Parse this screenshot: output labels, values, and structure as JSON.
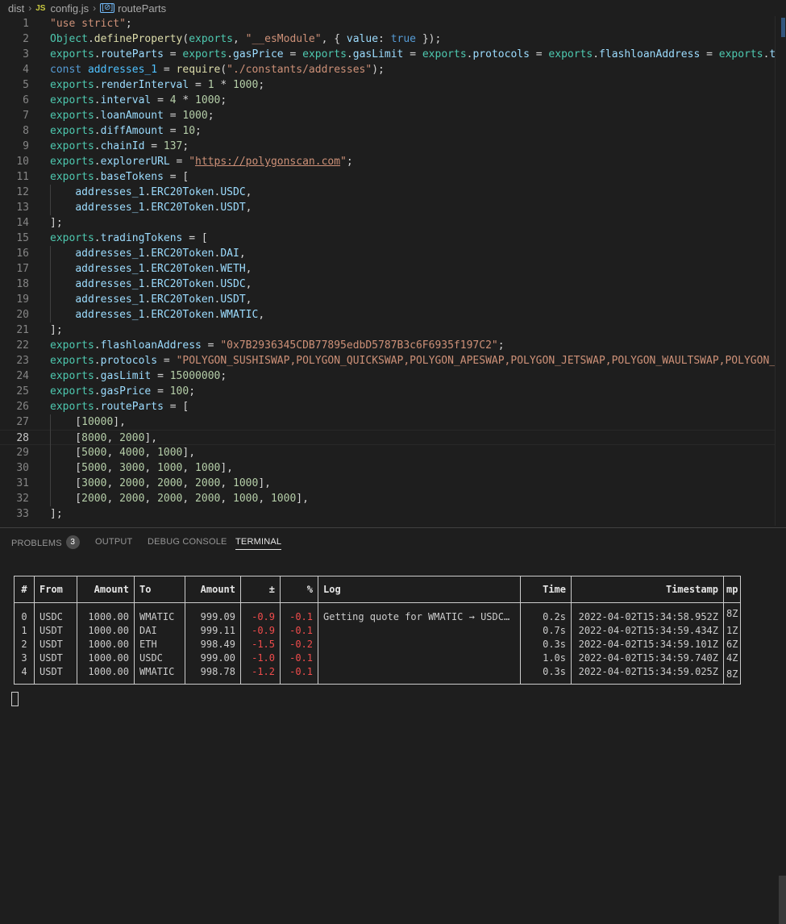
{
  "breadcrumb": {
    "folder": "dist",
    "file_badge": "JS",
    "file": "config.js",
    "symbol_badge": "[⊘]",
    "symbol": "routeParts"
  },
  "editor": {
    "active_line": 28,
    "lines": [
      {
        "n": "1",
        "t": [
          [
            "str",
            "\"use strict\""
          ],
          [
            "pun",
            ";"
          ]
        ]
      },
      {
        "n": "2",
        "t": [
          [
            "var",
            "Object"
          ],
          [
            "pun",
            "."
          ],
          [
            "fn",
            "defineProperty"
          ],
          [
            "pun",
            "("
          ],
          [
            "var",
            "exports"
          ],
          [
            "pun",
            ", "
          ],
          [
            "str",
            "\"__esModule\""
          ],
          [
            "pun",
            ", { "
          ],
          [
            "prop",
            "value"
          ],
          [
            "pun",
            ": "
          ],
          [
            "kw",
            "true"
          ],
          [
            "pun",
            " });"
          ]
        ]
      },
      {
        "n": "3",
        "t": [
          [
            "var",
            "exports"
          ],
          [
            "pun",
            "."
          ],
          [
            "prop",
            "routeParts"
          ],
          [
            "pun",
            " = "
          ],
          [
            "var",
            "exports"
          ],
          [
            "pun",
            "."
          ],
          [
            "prop",
            "gasPrice"
          ],
          [
            "pun",
            " = "
          ],
          [
            "var",
            "exports"
          ],
          [
            "pun",
            "."
          ],
          [
            "prop",
            "gasLimit"
          ],
          [
            "pun",
            " = "
          ],
          [
            "var",
            "exports"
          ],
          [
            "pun",
            "."
          ],
          [
            "prop",
            "protocols"
          ],
          [
            "pun",
            " = "
          ],
          [
            "var",
            "exports"
          ],
          [
            "pun",
            "."
          ],
          [
            "prop",
            "flashloanAddress"
          ],
          [
            "pun",
            " = "
          ],
          [
            "var",
            "exports"
          ],
          [
            "pun",
            "."
          ],
          [
            "prop",
            "tra"
          ]
        ]
      },
      {
        "n": "4",
        "t": [
          [
            "kw",
            "const "
          ],
          [
            "cst",
            "addresses_1"
          ],
          [
            "pun",
            " = "
          ],
          [
            "fn",
            "require"
          ],
          [
            "pun",
            "("
          ],
          [
            "str",
            "\"./constants/addresses\""
          ],
          [
            "pun",
            ");"
          ]
        ]
      },
      {
        "n": "5",
        "t": [
          [
            "var",
            "exports"
          ],
          [
            "pun",
            "."
          ],
          [
            "prop",
            "renderInterval"
          ],
          [
            "pun",
            " = "
          ],
          [
            "num",
            "1"
          ],
          [
            "pun",
            " * "
          ],
          [
            "num",
            "1000"
          ],
          [
            "pun",
            ";"
          ]
        ]
      },
      {
        "n": "6",
        "t": [
          [
            "var",
            "exports"
          ],
          [
            "pun",
            "."
          ],
          [
            "prop",
            "interval"
          ],
          [
            "pun",
            " = "
          ],
          [
            "num",
            "4"
          ],
          [
            "pun",
            " * "
          ],
          [
            "num",
            "1000"
          ],
          [
            "pun",
            ";"
          ]
        ]
      },
      {
        "n": "7",
        "t": [
          [
            "var",
            "exports"
          ],
          [
            "pun",
            "."
          ],
          [
            "prop",
            "loanAmount"
          ],
          [
            "pun",
            " = "
          ],
          [
            "num",
            "1000"
          ],
          [
            "pun",
            ";"
          ]
        ]
      },
      {
        "n": "8",
        "t": [
          [
            "var",
            "exports"
          ],
          [
            "pun",
            "."
          ],
          [
            "prop",
            "diffAmount"
          ],
          [
            "pun",
            " = "
          ],
          [
            "num",
            "10"
          ],
          [
            "pun",
            ";"
          ]
        ]
      },
      {
        "n": "9",
        "t": [
          [
            "var",
            "exports"
          ],
          [
            "pun",
            "."
          ],
          [
            "prop",
            "chainId"
          ],
          [
            "pun",
            " = "
          ],
          [
            "num",
            "137"
          ],
          [
            "pun",
            ";"
          ]
        ]
      },
      {
        "n": "10",
        "t": [
          [
            "var",
            "exports"
          ],
          [
            "pun",
            "."
          ],
          [
            "prop",
            "explorerURL"
          ],
          [
            "pun",
            " = "
          ],
          [
            "str",
            "\""
          ],
          [
            "link",
            "https://polygonscan.com"
          ],
          [
            "str",
            "\""
          ],
          [
            "pun",
            ";"
          ]
        ]
      },
      {
        "n": "11",
        "t": [
          [
            "var",
            "exports"
          ],
          [
            "pun",
            "."
          ],
          [
            "prop",
            "baseTokens"
          ],
          [
            "pun",
            " = ["
          ]
        ]
      },
      {
        "n": "12",
        "t": [
          [
            "pun",
            "    "
          ],
          [
            "prop",
            "addresses_1"
          ],
          [
            "pun",
            "."
          ],
          [
            "prop",
            "ERC20Token"
          ],
          [
            "pun",
            "."
          ],
          [
            "prop",
            "USDC"
          ],
          [
            "pun",
            ","
          ]
        ]
      },
      {
        "n": "13",
        "t": [
          [
            "pun",
            "    "
          ],
          [
            "prop",
            "addresses_1"
          ],
          [
            "pun",
            "."
          ],
          [
            "prop",
            "ERC20Token"
          ],
          [
            "pun",
            "."
          ],
          [
            "prop",
            "USDT"
          ],
          [
            "pun",
            ","
          ]
        ]
      },
      {
        "n": "14",
        "t": [
          [
            "pun",
            "];"
          ]
        ]
      },
      {
        "n": "15",
        "t": [
          [
            "var",
            "exports"
          ],
          [
            "pun",
            "."
          ],
          [
            "prop",
            "tradingTokens"
          ],
          [
            "pun",
            " = ["
          ]
        ]
      },
      {
        "n": "16",
        "t": [
          [
            "pun",
            "    "
          ],
          [
            "prop",
            "addresses_1"
          ],
          [
            "pun",
            "."
          ],
          [
            "prop",
            "ERC20Token"
          ],
          [
            "pun",
            "."
          ],
          [
            "prop",
            "DAI"
          ],
          [
            "pun",
            ","
          ]
        ]
      },
      {
        "n": "17",
        "t": [
          [
            "pun",
            "    "
          ],
          [
            "prop",
            "addresses_1"
          ],
          [
            "pun",
            "."
          ],
          [
            "prop",
            "ERC20Token"
          ],
          [
            "pun",
            "."
          ],
          [
            "prop",
            "WETH"
          ],
          [
            "pun",
            ","
          ]
        ]
      },
      {
        "n": "18",
        "t": [
          [
            "pun",
            "    "
          ],
          [
            "prop",
            "addresses_1"
          ],
          [
            "pun",
            "."
          ],
          [
            "prop",
            "ERC20Token"
          ],
          [
            "pun",
            "."
          ],
          [
            "prop",
            "USDC"
          ],
          [
            "pun",
            ","
          ]
        ]
      },
      {
        "n": "19",
        "t": [
          [
            "pun",
            "    "
          ],
          [
            "prop",
            "addresses_1"
          ],
          [
            "pun",
            "."
          ],
          [
            "prop",
            "ERC20Token"
          ],
          [
            "pun",
            "."
          ],
          [
            "prop",
            "USDT"
          ],
          [
            "pun",
            ","
          ]
        ]
      },
      {
        "n": "20",
        "t": [
          [
            "pun",
            "    "
          ],
          [
            "prop",
            "addresses_1"
          ],
          [
            "pun",
            "."
          ],
          [
            "prop",
            "ERC20Token"
          ],
          [
            "pun",
            "."
          ],
          [
            "prop",
            "WMATIC"
          ],
          [
            "pun",
            ","
          ]
        ]
      },
      {
        "n": "21",
        "t": [
          [
            "pun",
            "];"
          ]
        ]
      },
      {
        "n": "22",
        "t": [
          [
            "var",
            "exports"
          ],
          [
            "pun",
            "."
          ],
          [
            "prop",
            "flashloanAddress"
          ],
          [
            "pun",
            " = "
          ],
          [
            "str",
            "\"0x7B2936345CDB77895edbD5787B3c6F6935f197C2\""
          ],
          [
            "pun",
            ";"
          ]
        ]
      },
      {
        "n": "23",
        "t": [
          [
            "var",
            "exports"
          ],
          [
            "pun",
            "."
          ],
          [
            "prop",
            "protocols"
          ],
          [
            "pun",
            " = "
          ],
          [
            "str",
            "\"POLYGON_SUSHISWAP,POLYGON_QUICKSWAP,POLYGON_APESWAP,POLYGON_JETSWAP,POLYGON_WAULTSWAP,POLYGON_UN"
          ]
        ]
      },
      {
        "n": "24",
        "t": [
          [
            "var",
            "exports"
          ],
          [
            "pun",
            "."
          ],
          [
            "prop",
            "gasLimit"
          ],
          [
            "pun",
            " = "
          ],
          [
            "num",
            "15000000"
          ],
          [
            "pun",
            ";"
          ]
        ]
      },
      {
        "n": "25",
        "t": [
          [
            "var",
            "exports"
          ],
          [
            "pun",
            "."
          ],
          [
            "prop",
            "gasPrice"
          ],
          [
            "pun",
            " = "
          ],
          [
            "num",
            "100"
          ],
          [
            "pun",
            ";"
          ]
        ]
      },
      {
        "n": "26",
        "t": [
          [
            "var",
            "exports"
          ],
          [
            "pun",
            "."
          ],
          [
            "prop",
            "routeParts"
          ],
          [
            "pun",
            " = ["
          ]
        ]
      },
      {
        "n": "27",
        "t": [
          [
            "pun",
            "    ["
          ],
          [
            "num",
            "10000"
          ],
          [
            "pun",
            "],"
          ]
        ]
      },
      {
        "n": "28",
        "t": [
          [
            "pun",
            "    ["
          ],
          [
            "num",
            "8000"
          ],
          [
            "pun",
            ", "
          ],
          [
            "num",
            "2000"
          ],
          [
            "pun",
            "],"
          ]
        ]
      },
      {
        "n": "29",
        "t": [
          [
            "pun",
            "    ["
          ],
          [
            "num",
            "5000"
          ],
          [
            "pun",
            ", "
          ],
          [
            "num",
            "4000"
          ],
          [
            "pun",
            ", "
          ],
          [
            "num",
            "1000"
          ],
          [
            "pun",
            "],"
          ]
        ]
      },
      {
        "n": "30",
        "t": [
          [
            "pun",
            "    ["
          ],
          [
            "num",
            "5000"
          ],
          [
            "pun",
            ", "
          ],
          [
            "num",
            "3000"
          ],
          [
            "pun",
            ", "
          ],
          [
            "num",
            "1000"
          ],
          [
            "pun",
            ", "
          ],
          [
            "num",
            "1000"
          ],
          [
            "pun",
            "],"
          ]
        ]
      },
      {
        "n": "31",
        "t": [
          [
            "pun",
            "    ["
          ],
          [
            "num",
            "3000"
          ],
          [
            "pun",
            ", "
          ],
          [
            "num",
            "2000"
          ],
          [
            "pun",
            ", "
          ],
          [
            "num",
            "2000"
          ],
          [
            "pun",
            ", "
          ],
          [
            "num",
            "2000"
          ],
          [
            "pun",
            ", "
          ],
          [
            "num",
            "1000"
          ],
          [
            "pun",
            "],"
          ]
        ]
      },
      {
        "n": "32",
        "t": [
          [
            "pun",
            "    ["
          ],
          [
            "num",
            "2000"
          ],
          [
            "pun",
            ", "
          ],
          [
            "num",
            "2000"
          ],
          [
            "pun",
            ", "
          ],
          [
            "num",
            "2000"
          ],
          [
            "pun",
            ", "
          ],
          [
            "num",
            "2000"
          ],
          [
            "pun",
            ", "
          ],
          [
            "num",
            "1000"
          ],
          [
            "pun",
            ", "
          ],
          [
            "num",
            "1000"
          ],
          [
            "pun",
            "],"
          ]
        ]
      },
      {
        "n": "33",
        "t": [
          [
            "pun",
            "];"
          ]
        ]
      }
    ]
  },
  "panel": {
    "tabs": [
      "PROBLEMS",
      "OUTPUT",
      "DEBUG CONSOLE",
      "TERMINAL"
    ],
    "active_tab": "TERMINAL",
    "problems_count": "3"
  },
  "terminal": {
    "headers": [
      "#",
      "From",
      "Amount",
      "To",
      "Amount",
      "±",
      "%",
      "Log",
      "Time",
      "Timestamp",
      "mp"
    ],
    "rows": [
      [
        "0",
        "USDC",
        "1000.00",
        "WMATIC",
        "999.09",
        "-0.9",
        "-0.1",
        "Getting quote for WMATIC → USDC…",
        "0.2s",
        "2022-04-02T15:34:58.952Z",
        "8Z"
      ],
      [
        "1",
        "USDT",
        "1000.00",
        "DAI",
        "999.11",
        "-0.9",
        "-0.1",
        "",
        "0.7s",
        "2022-04-02T15:34:59.434Z",
        "1Z"
      ],
      [
        "2",
        "USDT",
        "1000.00",
        "ETH",
        "998.49",
        "-1.5",
        "-0.2",
        "",
        "0.3s",
        "2022-04-02T15:34:59.101Z",
        "6Z"
      ],
      [
        "3",
        "USDT",
        "1000.00",
        "USDC",
        "999.00",
        "-1.0",
        "-0.1",
        "",
        "1.0s",
        "2022-04-02T15:34:59.740Z",
        "4Z"
      ],
      [
        "4",
        "USDT",
        "1000.00",
        "WMATIC",
        "998.78",
        "-1.2",
        "-0.1",
        "",
        "0.3s",
        "2022-04-02T15:34:59.025Z",
        "8Z"
      ]
    ]
  }
}
